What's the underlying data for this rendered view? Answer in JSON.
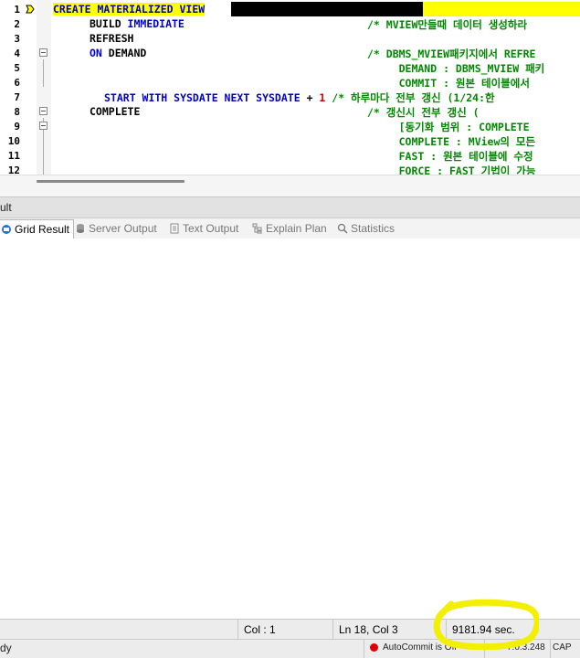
{
  "editor": {
    "lines": [
      {
        "num": "1",
        "code": "CREATE MATERIALIZED VIEW"
      },
      {
        "num": "2",
        "indent": "      ",
        "code": "BUILD ",
        "kw": "IMMEDIATE",
        "comment": "/* MVIEW만들때 데이터 생성하라"
      },
      {
        "num": "3",
        "indent": "      ",
        "code": "REFRESH"
      },
      {
        "num": "4",
        "indent": "      ",
        "kw": "ON",
        "code": " DEMAND",
        "comment": "/* DBMS_MVIEW패키지에서 REFRE"
      },
      {
        "num": "5",
        "comment": "     DEMAND : DBMS_MVIEW 패키"
      },
      {
        "num": "6",
        "comment": "     COMMIT : 원본 테이블에서"
      },
      {
        "num": "7",
        "kw1": "START WITH SYSDATE NEXT SYSDATE",
        "op": " + ",
        "numlit": "1",
        "comment": " /* 하루마다 전부 갱신 (1/24:한"
      },
      {
        "num": "8",
        "indent": "      ",
        "code": "COMPLETE",
        "comment": "/* 갱신시 전부 갱신 ("
      },
      {
        "num": "9",
        "comment": "     [동기화 범위 : COMPLETE"
      },
      {
        "num": "10",
        "comment": "     COMPLETE : MView의 모든"
      },
      {
        "num": "11",
        "comment": "     FAST : 원본 테이블에 수정"
      },
      {
        "num": "12",
        "comment": "     FORCE : FAST 기법이 가능"
      }
    ]
  },
  "panel": {
    "title": "ult"
  },
  "tabs": [
    {
      "label": "Grid Result",
      "icon": "grid-icon",
      "active": true
    },
    {
      "label": "Server Output",
      "icon": "database-icon",
      "active": false
    },
    {
      "label": "Text Output",
      "icon": "document-icon",
      "active": false
    },
    {
      "label": "Explain Plan",
      "icon": "plan-icon",
      "active": false
    },
    {
      "label": "Statistics",
      "icon": "statistics-icon",
      "active": false
    }
  ],
  "status": {
    "col": "Col : 1",
    "position": "Ln 18, Col 3",
    "elapsed": "9181.94 sec.",
    "ready": "dy",
    "autocommit": "AutoCommit is Off",
    "version": "7.0.3.248",
    "caps": "CAP"
  },
  "colors": {
    "keyword": "#0000cc",
    "comment": "#008800",
    "number": "#cc0000",
    "highlight": "#ffff00",
    "annotation": "#f2ef00"
  }
}
